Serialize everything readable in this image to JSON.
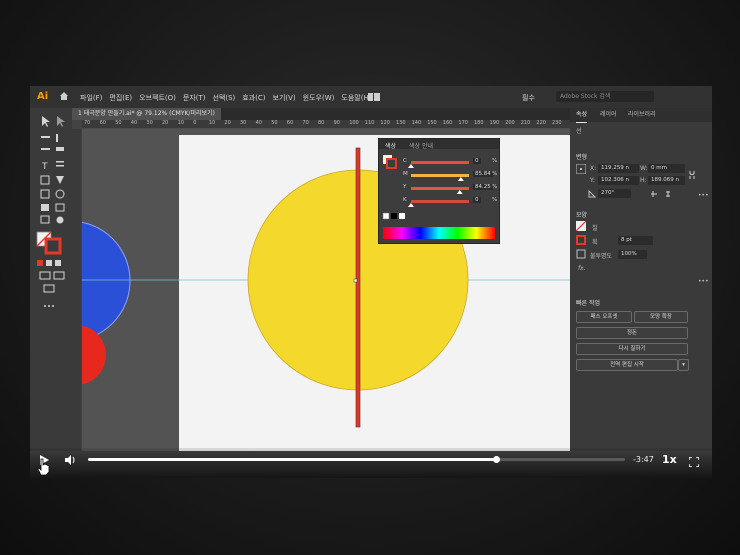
{
  "app": {
    "logo": "Ai",
    "menus": [
      "파일(F)",
      "편집(E)",
      "오브젝트(O)",
      "문자(T)",
      "선택(S)",
      "효과(C)",
      "보기(V)",
      "윈도우(W)",
      "도움말(H)"
    ],
    "workspace": "필수",
    "search_placeholder": "Adobe Stock 검색"
  },
  "document": {
    "tab_title": "1 태극문양 만들기.ai* @ 79.12% (CMYK/미리보기)"
  },
  "ruler_top": [
    "70",
    "60",
    "50",
    "40",
    "30",
    "20",
    "10",
    "0",
    "10",
    "20",
    "30",
    "40",
    "50",
    "60",
    "70",
    "80",
    "90",
    "100",
    "110",
    "120",
    "130",
    "140",
    "150",
    "160",
    "170",
    "180",
    "190",
    "200",
    "210",
    "220",
    "230"
  ],
  "color_panel": {
    "tab1": "색상",
    "tab2": "색상 안내",
    "sliders": [
      {
        "label": "C",
        "value": "0",
        "unit": "%",
        "fraction": 0.0
      },
      {
        "label": "M",
        "value": "85.84",
        "unit": "%",
        "fraction": 0.86
      },
      {
        "label": "Y",
        "value": "84.25",
        "unit": "%",
        "fraction": 0.84
      },
      {
        "label": "K",
        "value": "0",
        "unit": "%",
        "fraction": 0.0
      }
    ]
  },
  "properties": {
    "tabs": [
      "속성",
      "레이어",
      "라이브러리"
    ],
    "section_none": "선",
    "transform_title": "변형",
    "x_label": "X:",
    "x_value": "119.259 n",
    "y_label": "Y:",
    "y_value": "102.306 n",
    "w_label": "W:",
    "w_value": "0 mm",
    "h_label": "H:",
    "h_value": "189.069 n",
    "angle_value": "270°",
    "appearance_title": "모양",
    "fill_label": "칠",
    "stroke_label": "획",
    "stroke_value": "8 pt",
    "opacity_label": "불투명도",
    "opacity_value": "100%",
    "fx_label": "fx.",
    "quick_actions_title": "빠른 작업",
    "btn_offset": "패스 오프셋",
    "btn_expand": "모양 확장",
    "btn_align": "정돈",
    "btn_recolor": "다시 칠하기",
    "btn_start_global": "전역 편집 시작"
  },
  "player": {
    "progress": 0.76,
    "time_remaining": "-3:47",
    "speed": "1x"
  },
  "colors": {
    "yellow_circle": "#f4d92c",
    "red_line": "#d83a2a",
    "blue_shape": "#2a50d8",
    "red_shape": "#e8281e",
    "artboard": "#f3f3f3",
    "ai_orange": "#ff9a00"
  }
}
